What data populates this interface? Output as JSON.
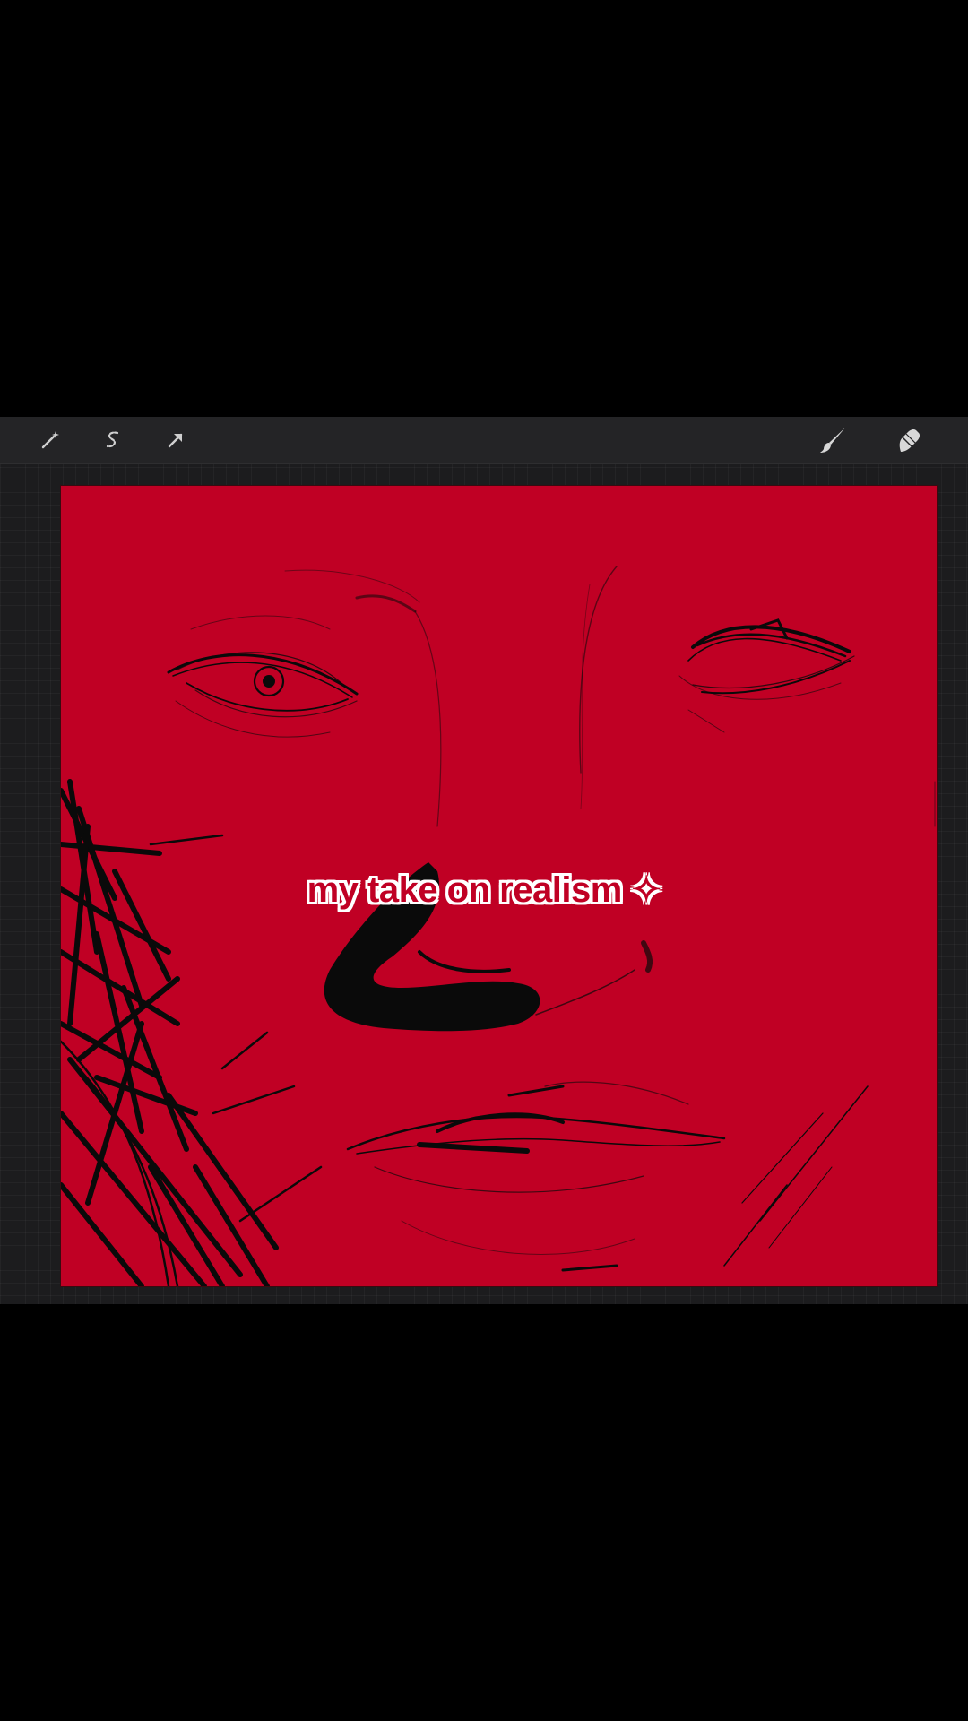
{
  "caption": {
    "text": "my take on realism",
    "sparkle": "✧"
  },
  "toolbar": {
    "left_tools": [
      "magic-wand-icon",
      "selection-icon",
      "transform-arrow-icon"
    ],
    "right_tools": [
      "brush-icon",
      "smudge-icon"
    ]
  },
  "colors": {
    "canvas": "#c00024",
    "toolbar": "#242426",
    "background": "#000000",
    "ink": "#0a0a0a"
  }
}
